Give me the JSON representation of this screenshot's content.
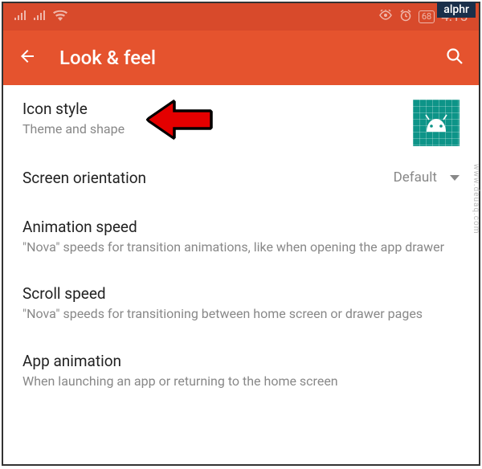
{
  "badge": "alphr",
  "statusbar": {
    "battery": "68",
    "time": "4:15"
  },
  "appbar": {
    "title": "Look & feel"
  },
  "settings": {
    "icon_style": {
      "title": "Icon style",
      "sub": "Theme and shape"
    },
    "orientation": {
      "title": "Screen orientation",
      "value": "Default"
    },
    "animation_speed": {
      "title": "Animation speed",
      "sub": "\"Nova\" speeds for transition animations, like when opening the app drawer"
    },
    "scroll_speed": {
      "title": "Scroll speed",
      "sub": "\"Nova\" speeds for transitioning between home screen or drawer pages"
    },
    "app_animation": {
      "title": "App animation",
      "sub": "When launching an app or returning to the home screen"
    }
  },
  "watermark": "www.deuaq.com"
}
